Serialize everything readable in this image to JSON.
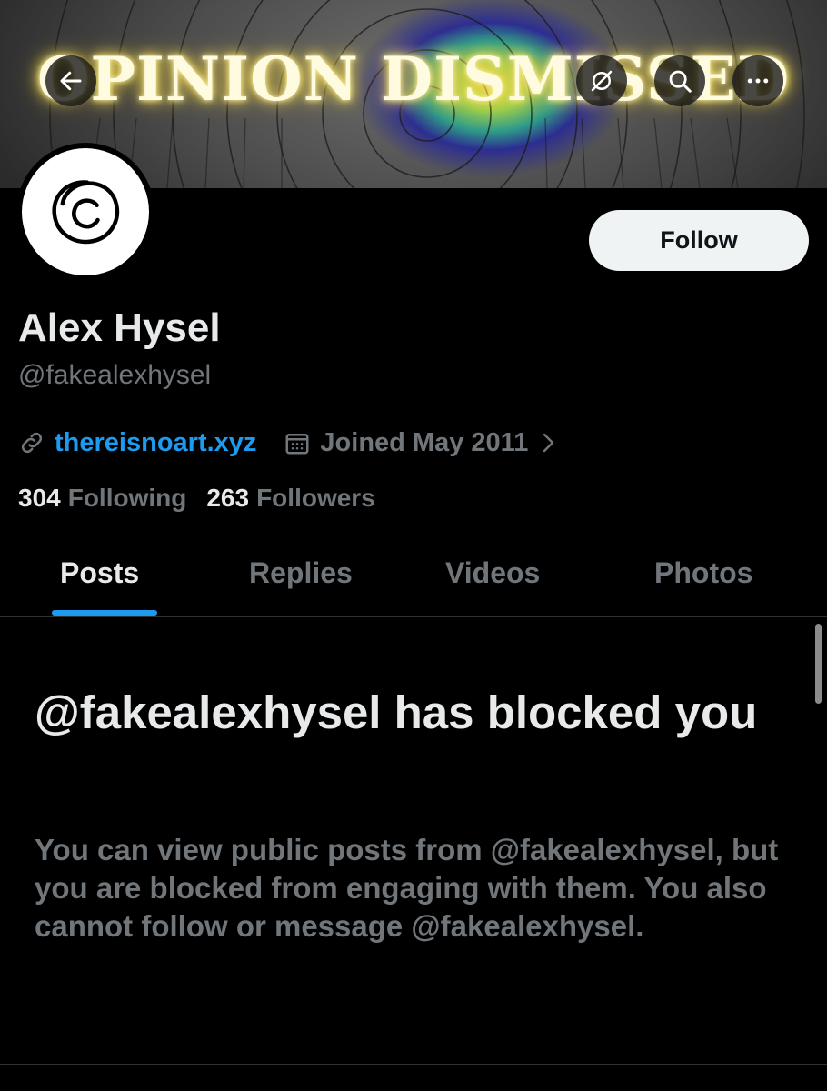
{
  "banner": {
    "title": "OPINION DISMISSED",
    "back_icon": "arrow-left-icon",
    "icons": [
      "no-notifications-icon",
      "search-icon",
      "more-options-icon"
    ]
  },
  "profile": {
    "avatar_icon": "circled-c-icon",
    "follow_label": "Follow",
    "name": "Alex Hysel",
    "handle": "@fakealexhysel",
    "website": "thereisnoart.xyz",
    "joined": "Joined May 2011",
    "following_count": "304",
    "following_label": "Following",
    "followers_count": "263",
    "followers_label": "Followers"
  },
  "tabs": [
    "Posts",
    "Replies",
    "Videos",
    "Photos"
  ],
  "blocked": {
    "title": "@fakealexhysel has blocked you",
    "message": "You can view public posts from @fakealexhysel, but you are blocked from engaging with them. You also cannot follow or message @fakealexhysel."
  },
  "colors": {
    "accent": "#1d9bf0",
    "background": "#000000",
    "muted_text": "#71767b",
    "banner_glow": "#f7e36a"
  }
}
